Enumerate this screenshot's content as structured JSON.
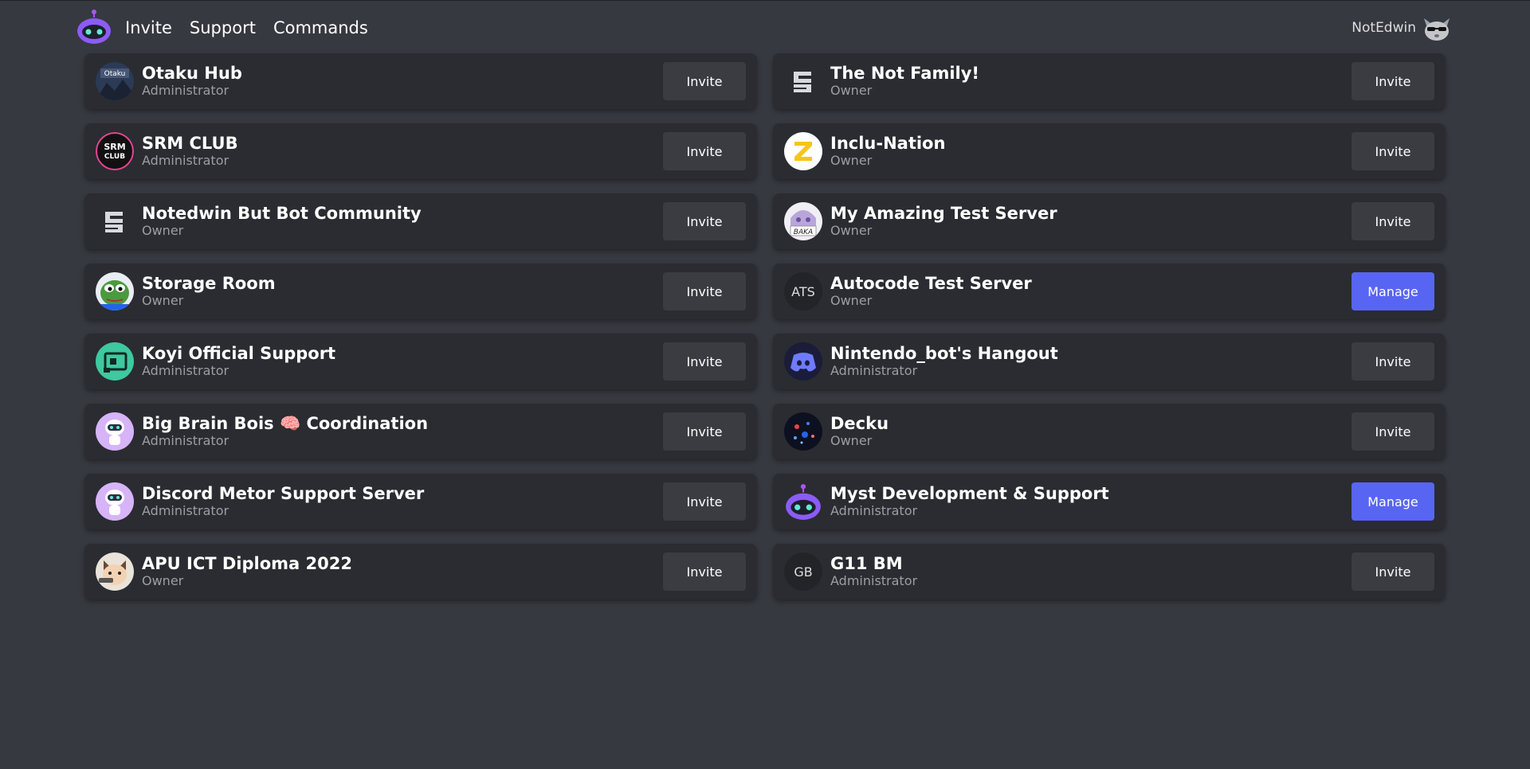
{
  "nav": {
    "links": [
      "Invite",
      "Support",
      "Commands"
    ]
  },
  "user": {
    "name": "NotEdwin"
  },
  "colors": {
    "manage": "#5865f2",
    "invite": "#3a3c42",
    "card": "#2a2c31",
    "background": "#36393f"
  },
  "servers": [
    {
      "name": "Otaku Hub",
      "role": "Administrator",
      "action": "Invite",
      "icon": "otaku-hub-icon"
    },
    {
      "name": "The Not Family!",
      "role": "Owner",
      "action": "Invite",
      "icon": "notfamily-logo-icon"
    },
    {
      "name": "SRM CLUB",
      "role": "Administrator",
      "action": "Invite",
      "icon": "srm-club-icon"
    },
    {
      "name": "Inclu-Nation",
      "role": "Owner",
      "action": "Invite",
      "icon": "z-logo-icon"
    },
    {
      "name": "Notedwin But Bot Community",
      "role": "Owner",
      "action": "Invite",
      "icon": "notfamily-logo-icon"
    },
    {
      "name": "My Amazing Test Server",
      "role": "Owner",
      "action": "Invite",
      "icon": "anime-baka-icon"
    },
    {
      "name": "Storage Room",
      "role": "Owner",
      "action": "Invite",
      "icon": "pepe-frog-icon"
    },
    {
      "name": "Autocode Test Server",
      "role": "Owner",
      "action": "Manage",
      "icon": "initials-icon",
      "initials": "ATS"
    },
    {
      "name": "Koyi Official Support",
      "role": "Administrator",
      "action": "Invite",
      "icon": "koyi-logo-icon"
    },
    {
      "name": "Nintendo_bot's Hangout",
      "role": "Administrator",
      "action": "Invite",
      "icon": "discord-logo-icon"
    },
    {
      "name": "Big Brain Bois 🧠 Coordination",
      "role": "Administrator",
      "action": "Invite",
      "icon": "robot-mascot-icon"
    },
    {
      "name": "Decku",
      "role": "Owner",
      "action": "Invite",
      "icon": "decku-icon"
    },
    {
      "name": "Discord Metor Support Server",
      "role": "Administrator",
      "action": "Invite",
      "icon": "robot-mascot-icon"
    },
    {
      "name": "Myst Development & Support",
      "role": "Administrator",
      "action": "Manage",
      "icon": "bot-logo-icon"
    },
    {
      "name": "APU ICT Diploma 2022",
      "role": "Owner",
      "action": "Invite",
      "icon": "cartoon-cat-icon"
    },
    {
      "name": "G11 BM",
      "role": "Administrator",
      "action": "Invite",
      "icon": "initials-icon",
      "initials": "GB"
    }
  ]
}
